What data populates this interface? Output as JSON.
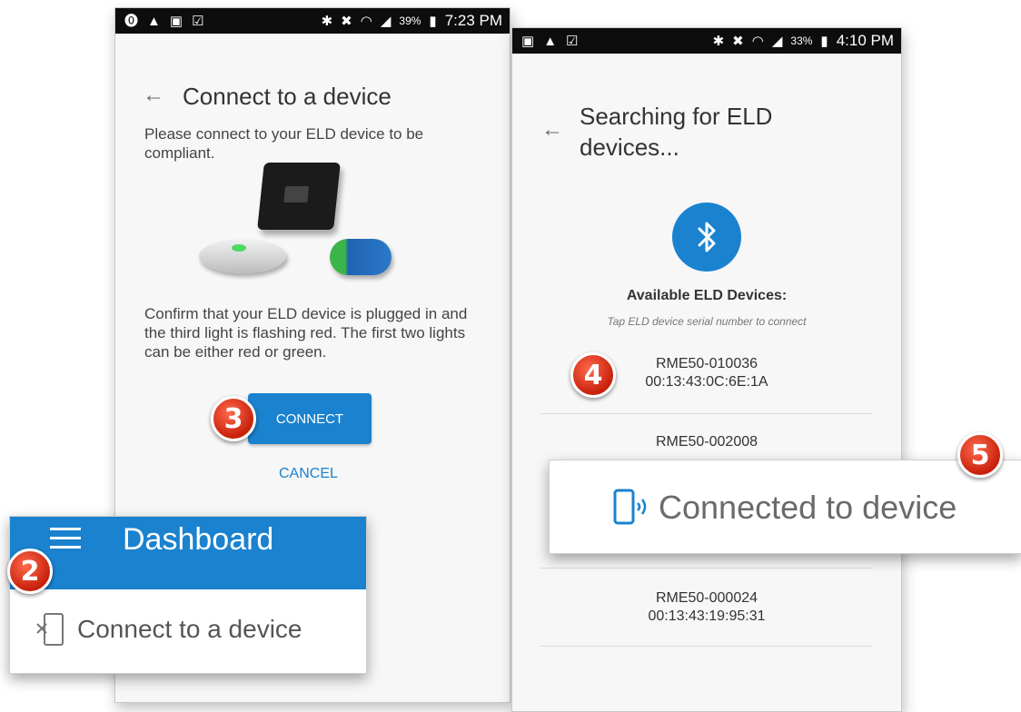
{
  "phone1": {
    "status_bar": {
      "battery": "39%",
      "time": "7:23 PM"
    },
    "title": "Connect to a device",
    "description": "Please connect to your ELD device to be compliant.",
    "confirm_text": "Confirm that your ELD device is plugged in and the third light is flashing red. The first two lights can be either red or green.",
    "connect_label": "CONNECT",
    "cancel_label": "CANCEL"
  },
  "phone2": {
    "status_bar": {
      "battery": "33%",
      "time": "4:10 PM"
    },
    "title": "Searching for ELD devices...",
    "available_title": "Available ELD Devices:",
    "available_subtitle": "Tap ELD device serial number to connect",
    "devices": [
      {
        "serial": "RME50-010036",
        "mac": "00:13:43:0C:6E:1A"
      },
      {
        "serial": "RME50-002008",
        "mac": ""
      },
      {
        "serial": "RME50-000024",
        "mac": "00:13:43:19:95:31"
      }
    ]
  },
  "dashboard": {
    "title": "Dashboard",
    "menu_item": "Connect to a device"
  },
  "connected": {
    "label": "Connected to device"
  },
  "badges": [
    "2",
    "3",
    "4",
    "5"
  ],
  "colors": {
    "accent": "#1a82cf",
    "badge": "#d9341a"
  }
}
